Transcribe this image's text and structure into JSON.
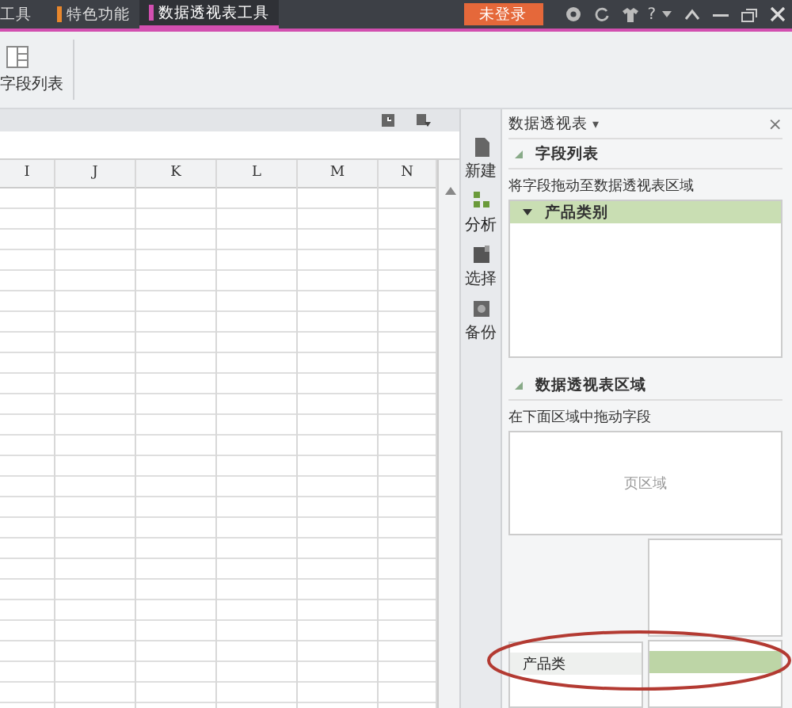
{
  "menu_tabs": [
    {
      "label": "工具",
      "selected": false
    },
    {
      "label": "特色功能",
      "selected": false,
      "color": "#e8872c"
    },
    {
      "label": "数据透视表工具",
      "selected": true,
      "color": "#d24fb0"
    }
  ],
  "login_button": "未登录",
  "help_button": "?",
  "ribbon": {
    "buttons": [
      {
        "label": "字段列表"
      }
    ]
  },
  "sheet": {
    "columns": [
      "I",
      "J",
      "K",
      "L",
      "M",
      "N"
    ]
  },
  "side_tools": [
    {
      "label": "新建",
      "selected": false
    },
    {
      "label": "分析",
      "selected": true
    },
    {
      "label": "选择",
      "selected": false
    },
    {
      "label": "备份",
      "selected": false
    }
  ],
  "pane": {
    "title": "数据透视表",
    "caret": "▾",
    "close": "×",
    "field_section": {
      "title": "字段列表",
      "hint": "将字段拖动至数据透视表区域",
      "fields": [
        {
          "label": "产品类别",
          "selected": true
        }
      ]
    },
    "area_section": {
      "title": "数据透视表区域",
      "hint": "在下面区域中拖动字段",
      "page_area": "页区域",
      "row_area_fields": [
        {
          "label": "产品类",
          "selected": false
        }
      ],
      "data_area_fields": [
        {
          "selected": true
        }
      ]
    }
  },
  "annotation": {
    "kind": "ellipse"
  }
}
